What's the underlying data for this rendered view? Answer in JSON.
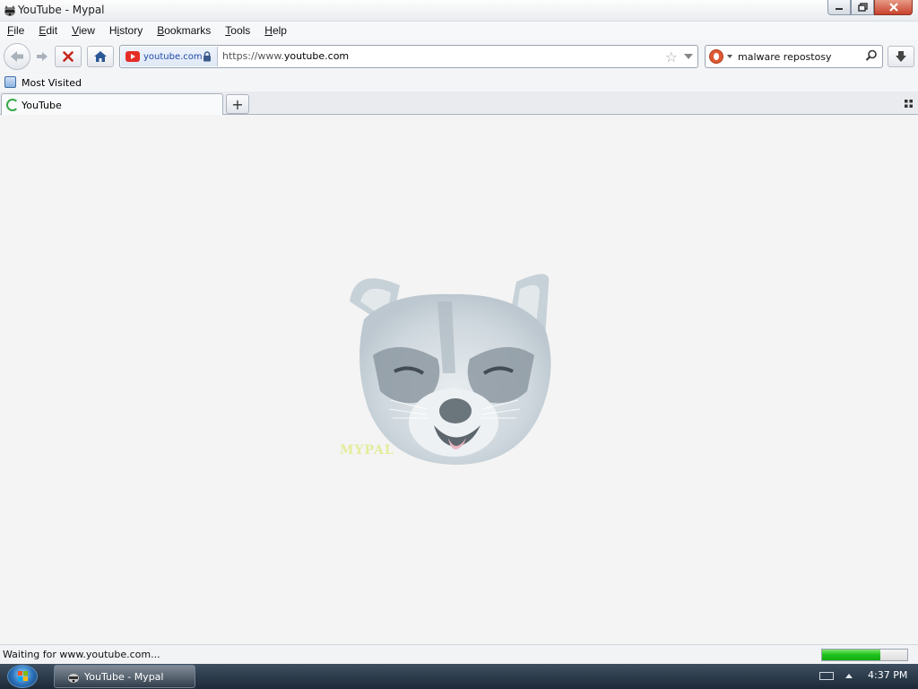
{
  "window": {
    "title": "YouTube - Mypal"
  },
  "menu": [
    "File",
    "Edit",
    "View",
    "History",
    "Bookmarks",
    "Tools",
    "Help"
  ],
  "menu_underline_index": [
    0,
    0,
    0,
    1,
    0,
    0,
    0
  ],
  "nav": {
    "identity_label": "youtube.com",
    "url_prefix": "https://www.",
    "url_host": "youtube.com",
    "search_value": "malware repostosy"
  },
  "bookmarks": {
    "most_visited": "Most Visited"
  },
  "tabs": [
    {
      "label": "YouTube",
      "loading": true
    }
  ],
  "content": {
    "watermark": "MYPAL"
  },
  "status": {
    "text": "Waiting for www.youtube.com...",
    "progress_fraction": 0.68
  },
  "taskbar": {
    "app_label": "YouTube - Mypal",
    "clock": "4:37 PM"
  },
  "colors": {
    "progress": "#1cc21a",
    "youtube_red": "#e52d27",
    "close_button": "#c8422c"
  }
}
